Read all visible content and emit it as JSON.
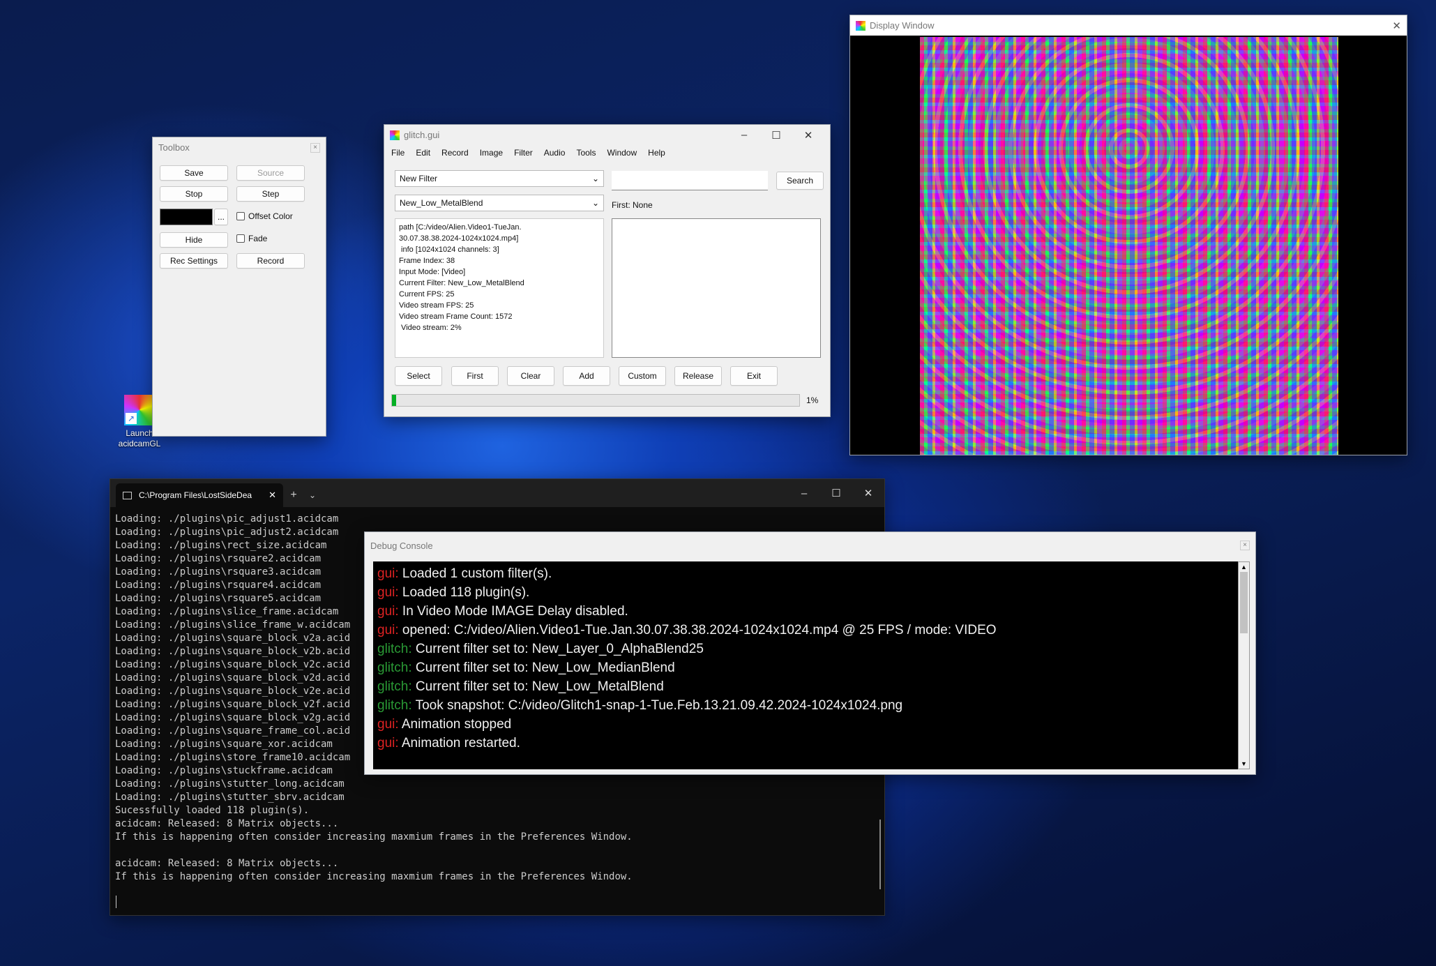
{
  "desktop": {
    "icon_label_1": "Launch",
    "icon_label_2": "acidcamGL"
  },
  "toolbox": {
    "title": "Toolbox",
    "save": "Save",
    "source": "Source",
    "stop": "Stop",
    "step": "Step",
    "ellipsis": "...",
    "offset_color": "Offset Color",
    "hide": "Hide",
    "fade": "Fade",
    "rec_settings": "Rec Settings",
    "record": "Record",
    "color_swatch": "#000000"
  },
  "glitch": {
    "title": "glitch.gui",
    "menu": [
      "File",
      "Edit",
      "Record",
      "Image",
      "Filter",
      "Audio",
      "Tools",
      "Window",
      "Help"
    ],
    "filter_select": "New Filter",
    "current_filter_select": "New_Low_MetalBlend",
    "search_value": "",
    "search_button": "Search",
    "first_label": "First: None",
    "info_lines": [
      "path [C:/video/Alien.Video1-TueJan.",
      "30.07.38.38.2024-1024x1024.mp4]",
      " info [1024x1024 channels: 3]",
      "Frame Index: 38",
      "Input Mode: [Video]",
      "Current Filter: New_Low_MetalBlend",
      "Current FPS: 25",
      "Video stream FPS: 25",
      "Video stream Frame Count: 1572",
      " Video stream: 2%"
    ],
    "buttons": [
      "Select",
      "First",
      "Clear",
      "Add",
      "Custom",
      "Release",
      "Exit"
    ],
    "progress_fraction": 0.01,
    "progress_label": "1%"
  },
  "display": {
    "title": "Display Window"
  },
  "terminal": {
    "tab_title": "C:\\Program Files\\LostSideDea",
    "lines": [
      "Loading: ./plugins\\pic_adjust1.acidcam",
      "Loading: ./plugins\\pic_adjust2.acidcam",
      "Loading: ./plugins\\rect_size.acidcam",
      "Loading: ./plugins\\rsquare2.acidcam",
      "Loading: ./plugins\\rsquare3.acidcam",
      "Loading: ./plugins\\rsquare4.acidcam",
      "Loading: ./plugins\\rsquare5.acidcam",
      "Loading: ./plugins\\slice_frame.acidcam",
      "Loading: ./plugins\\slice_frame_w.acidcam",
      "Loading: ./plugins\\square_block_v2a.acid",
      "Loading: ./plugins\\square_block_v2b.acid",
      "Loading: ./plugins\\square_block_v2c.acid",
      "Loading: ./plugins\\square_block_v2d.acid",
      "Loading: ./plugins\\square_block_v2e.acid",
      "Loading: ./plugins\\square_block_v2f.acid",
      "Loading: ./plugins\\square_block_v2g.acid",
      "Loading: ./plugins\\square_frame_col.acid",
      "Loading: ./plugins\\square_xor.acidcam",
      "Loading: ./plugins\\store_frame10.acidcam",
      "Loading: ./plugins\\stuckframe.acidcam",
      "Loading: ./plugins\\stutter_long.acidcam",
      "Loading: ./plugins\\stutter_sbrv.acidcam",
      "Sucessfully loaded 118 plugin(s).",
      "acidcam: Released: 8 Matrix objects...",
      "If this is happening often consider increasing maxmium frames in the Preferences Window.",
      "",
      "acidcam: Released: 8 Matrix objects...",
      "If this is happening often consider increasing maxmium frames in the Preferences Window."
    ]
  },
  "debug": {
    "title": "Debug Console",
    "lines": [
      {
        "tag": "gui:",
        "text": " Loaded 1 custom filter(s)."
      },
      {
        "tag": "gui:",
        "text": " Loaded 118 plugin(s)."
      },
      {
        "tag": "gui:",
        "text": " In Video Mode IMAGE Delay disabled."
      },
      {
        "tag": "gui:",
        "text": " opened: C:/video/Alien.Video1-Tue.Jan.30.07.38.38.2024-1024x1024.mp4 @ 25 FPS / mode: VIDEO"
      },
      {
        "tag": "glitch:",
        "text": " Current filter set to: New_Layer_0_AlphaBlend25"
      },
      {
        "tag": "glitch:",
        "text": " Current filter set to: New_Low_MedianBlend"
      },
      {
        "tag": "glitch:",
        "text": " Current filter set to: New_Low_MetalBlend"
      },
      {
        "tag": "glitch:",
        "text": " Took snapshot: C:/video/Glitch1-snap-1-Tue.Feb.13.21.09.42.2024-1024x1024.png"
      },
      {
        "tag": "gui:",
        "text": " Animation stopped"
      },
      {
        "tag": "gui:",
        "text": " Animation restarted."
      }
    ]
  }
}
